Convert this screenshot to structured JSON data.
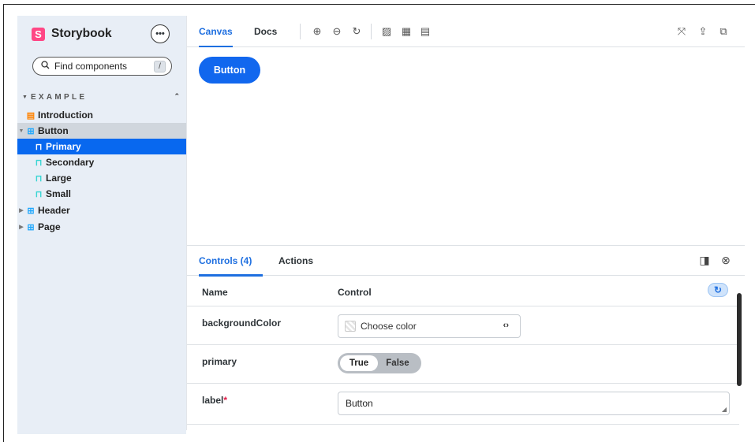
{
  "app": {
    "name": "Storybook",
    "logo_letter": "S",
    "more_label": "•••",
    "brand_color": "#ff4785",
    "accent_color": "#1e6fe0"
  },
  "sidebar": {
    "search_placeholder": "Find components",
    "search_shortcut": "/",
    "section_title": "EXAMPLE",
    "items": [
      {
        "label": "Introduction",
        "icon": "document-icon",
        "type": "doc"
      },
      {
        "label": "Button",
        "icon": "component-icon",
        "type": "component",
        "expanded": true
      },
      {
        "label": "Primary",
        "icon": "bookmark-icon",
        "type": "story",
        "selected": true
      },
      {
        "label": "Secondary",
        "icon": "bookmark-icon",
        "type": "story"
      },
      {
        "label": "Large",
        "icon": "bookmark-icon",
        "type": "story"
      },
      {
        "label": "Small",
        "icon": "bookmark-icon",
        "type": "story"
      },
      {
        "label": "Header",
        "icon": "component-icon",
        "type": "component",
        "expanded": false
      },
      {
        "label": "Page",
        "icon": "component-icon",
        "type": "component",
        "expanded": false
      }
    ]
  },
  "toolbar": {
    "tabs": [
      {
        "label": "Canvas",
        "active": true
      },
      {
        "label": "Docs",
        "active": false
      }
    ],
    "icons": [
      "zoom-in-icon",
      "zoom-out-icon",
      "zoom-reset-icon",
      "background-icon",
      "grid-icon",
      "measure-icon",
      "fullscreen-icon",
      "share-icon",
      "copy-link-icon"
    ]
  },
  "preview": {
    "button_label": "Button"
  },
  "addons": {
    "tabs": [
      {
        "label": "Controls (4)",
        "active": true
      },
      {
        "label": "Actions",
        "active": false
      }
    ],
    "table": {
      "headers": {
        "name": "Name",
        "control": "Control"
      },
      "rows": [
        {
          "name": "backgroundColor",
          "control": "color",
          "placeholder": "Choose color",
          "code_icon": "‹›"
        },
        {
          "name": "primary",
          "control": "boolean",
          "true_label": "True",
          "false_label": "False",
          "value": true
        },
        {
          "name": "label",
          "required_mark": "*",
          "control": "text",
          "value": "Button"
        }
      ]
    }
  }
}
